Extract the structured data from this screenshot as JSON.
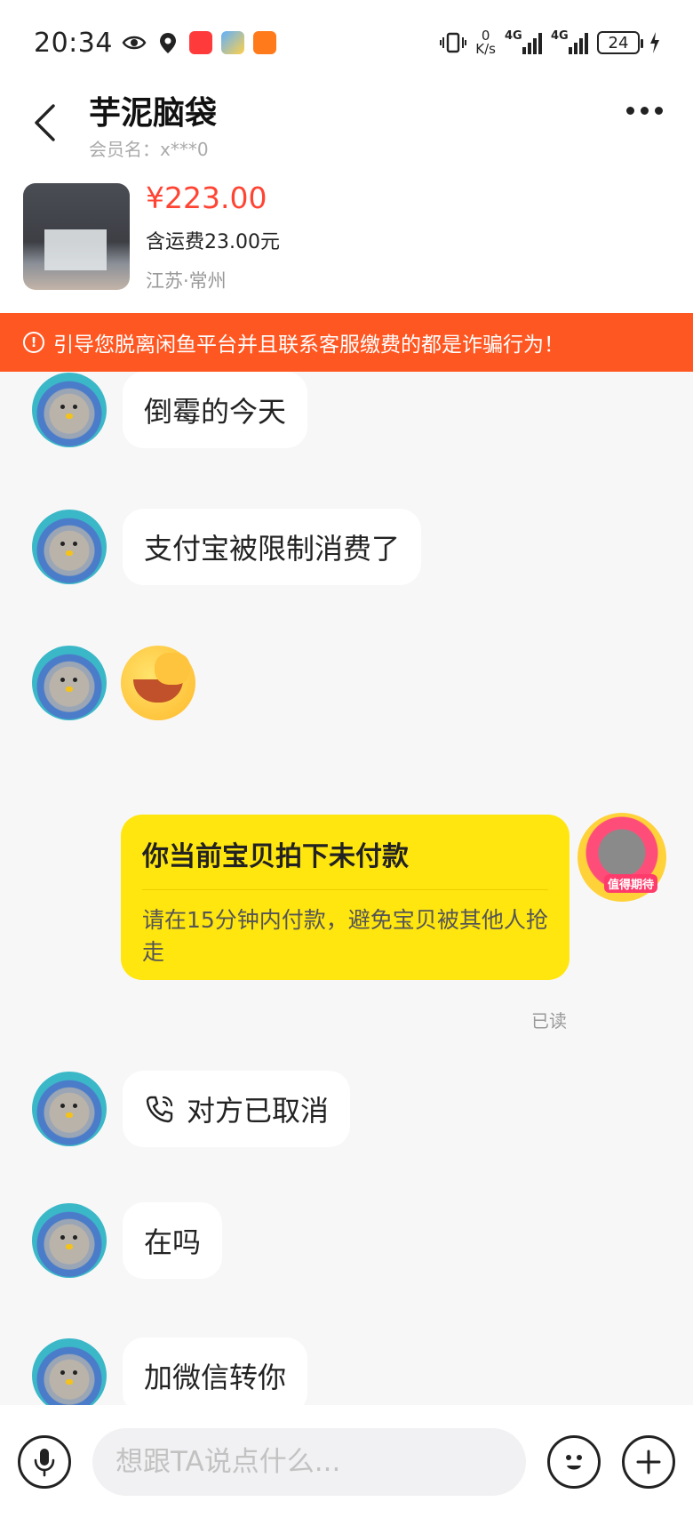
{
  "status_bar": {
    "time": "20:34",
    "net_speed_value": "0",
    "net_speed_unit": "K/s",
    "sim1_type": "4G",
    "sim2_type": "4G",
    "battery": "24"
  },
  "header": {
    "title": "芋泥脑袋",
    "subtitle": "会员名：x***0"
  },
  "product": {
    "price": "¥223.00",
    "shipping": "含运费23.00元",
    "location": "江苏·常州"
  },
  "warning": {
    "text": "引导您脱离闲鱼平台并且联系客服缴费的都是诈骗行为！"
  },
  "messages": {
    "m1": "倒霉的今天",
    "m2": "支付宝被限制消费了",
    "card_title": "你当前宝贝拍下未付款",
    "card_desc": "请在15分钟内付款，避免宝贝被其他人抢走",
    "read": "已读",
    "call": "对方已取消",
    "m5": "在吗",
    "m6": "加微信转你"
  },
  "own_avatar_badge": "值得期待",
  "input": {
    "placeholder": "想跟TA说点什么..."
  },
  "colors": {
    "price": "#ff4433",
    "warning_bg": "#ff5722",
    "own_bubble": "#ffe60f"
  }
}
